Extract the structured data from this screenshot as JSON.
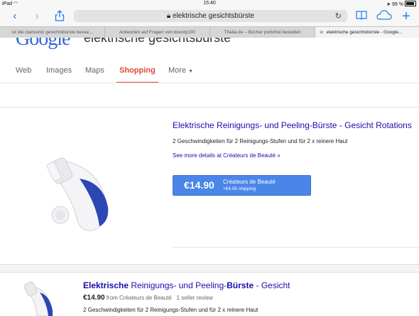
{
  "status_bar": {
    "device": "iPad",
    "time": "15:40",
    "battery": "99 %"
  },
  "toolbar": {
    "address": "elektrische gesichtsbürste"
  },
  "tabs": [
    {
      "label": "ist die clarisonic gesichtsbürste besse..."
    },
    {
      "label": "Antworten auf Fragen von bounty100"
    },
    {
      "label": "Thalia.de – Bücher portofrei bestellen"
    },
    {
      "label": "elektrische gesichtsbürste - Google..."
    }
  ],
  "google": {
    "logo": "Google",
    "query": "elektrische gesichtsbürste",
    "nav": [
      "Web",
      "Images",
      "Maps",
      "Shopping",
      "More"
    ]
  },
  "product1": {
    "title": "Elektrische Reinigungs- und Peeling-Bürste - Gesicht Rotations",
    "description": "2 Geschwindigkeiten für 2 Reinigungs-Stufen und für 2 x reinere Haut",
    "see_more": "See more details at Créateurs de Beauté »",
    "price": "€14.90",
    "seller": "Créateurs de Beauté",
    "shipping": "+€4.95 shipping"
  },
  "product2": {
    "title_bold1": "Elektrische",
    "title_mid": " Reinigungs- und Peeling-",
    "title_bold2": "Bürste",
    "title_end": " - Gesicht",
    "price": "€14.90",
    "price_meta": " from Créateurs de Beauté   1 seller review",
    "description": "2 Geschwindigkeiten für 2 Reinigungs-Stufen und für 2 x reinere Haut"
  },
  "colors": {
    "accent": "#1a7ef5",
    "link": "#1a0dab",
    "shopping_red": "#dd4b39",
    "price_button": "#4a86e8"
  }
}
